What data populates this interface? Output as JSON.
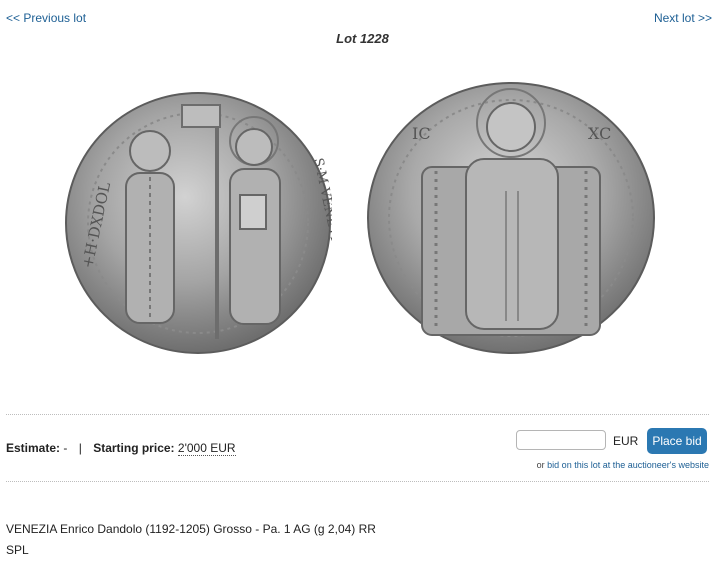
{
  "nav": {
    "prev_label": "<< Previous lot",
    "next_label": "Next lot >>"
  },
  "lot": {
    "title": "Lot 1228"
  },
  "images": {
    "obverse_icon": "coin-obverse-icon",
    "reverse_icon": "coin-reverse-icon",
    "obverse_legend": "+H·DXDOL",
    "obverse_legend_right": "S·M·VENETI",
    "reverse_letters": [
      "IC",
      "XC"
    ]
  },
  "pricing": {
    "estimate_label": "Estimate:",
    "estimate_value": "-",
    "separator": "|",
    "starting_label": "Starting price:",
    "starting_value": "2'000 EUR"
  },
  "bid": {
    "input_value": "",
    "currency": "EUR",
    "button_label": "Place bid",
    "alt_prefix": "or",
    "alt_link": "bid on this lot at the auctioneer's website"
  },
  "description": {
    "line1": "VENEZIA Enrico Dandolo (1192-1205) Grosso - Pa. 1 AG (g 2,04) RR",
    "line2": "SPL"
  },
  "colors": {
    "link": "#1d5f94",
    "button": "#2b78b2",
    "coin_silver": "#9c9c9c"
  }
}
